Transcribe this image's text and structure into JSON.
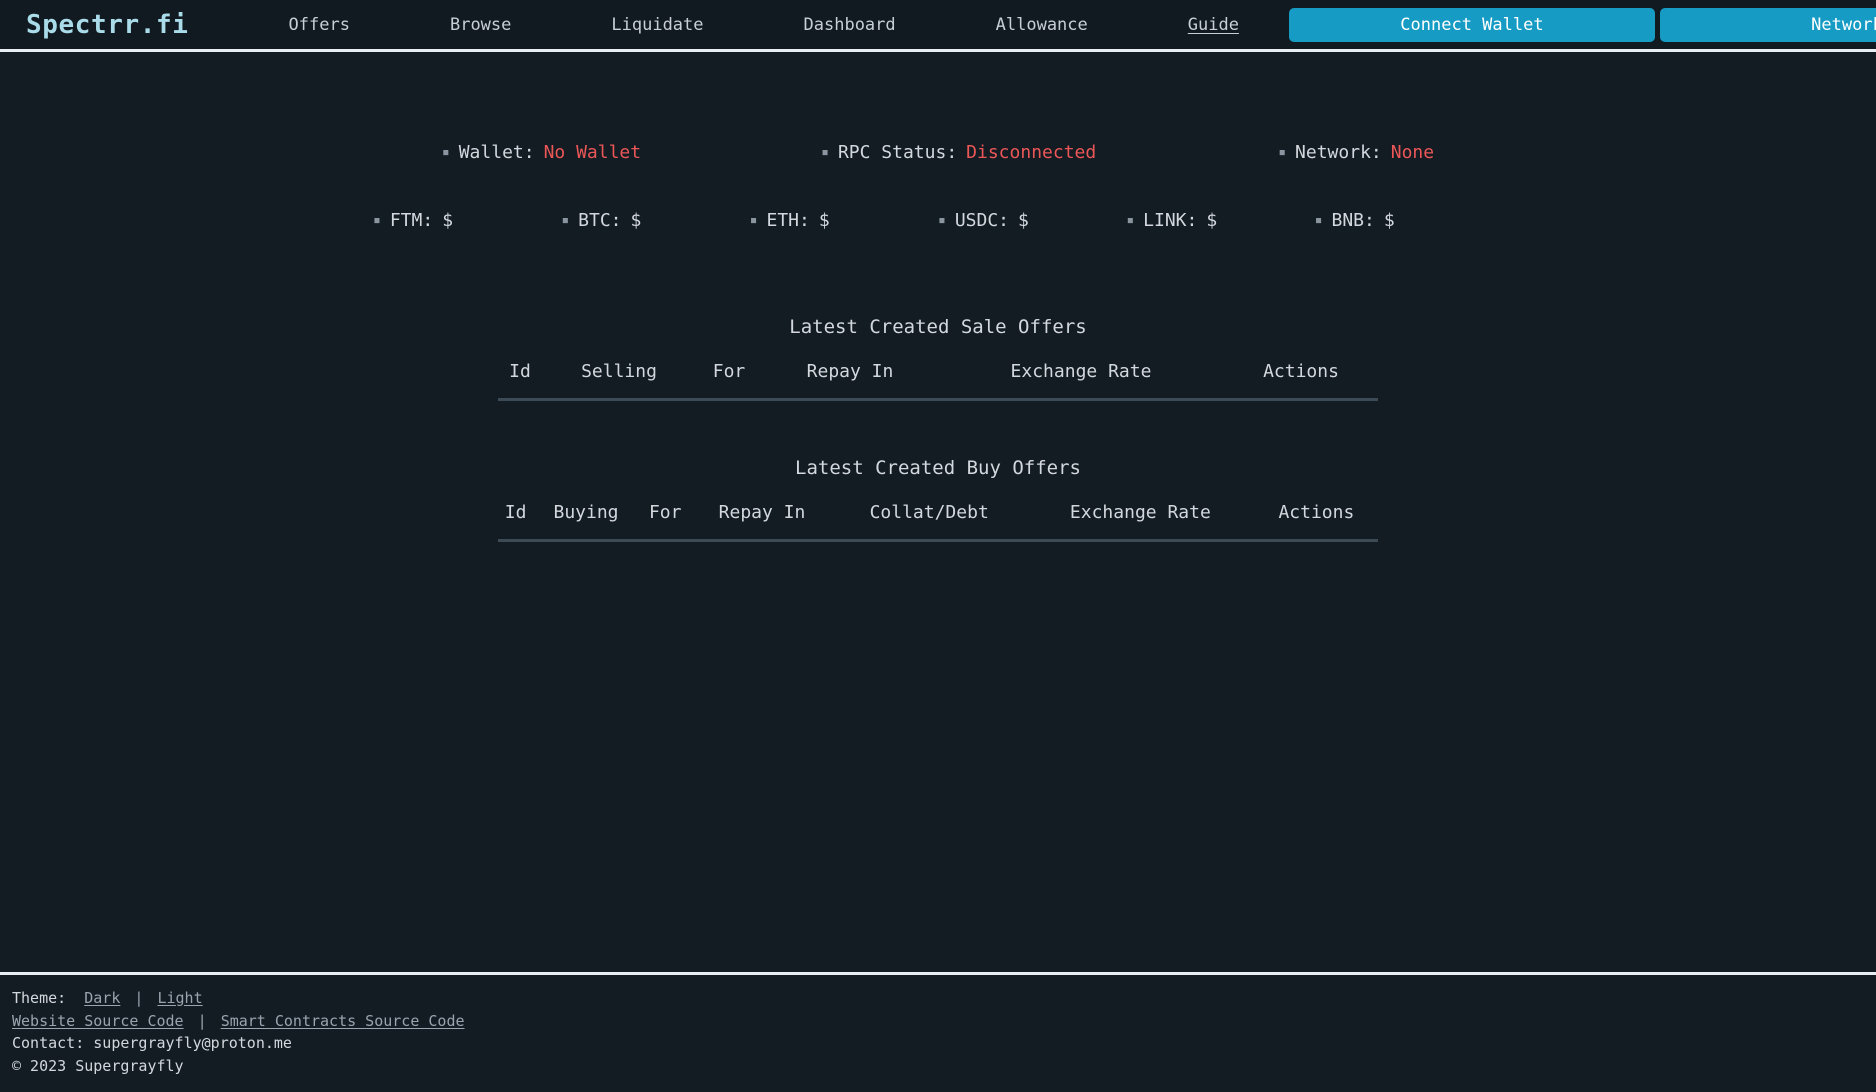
{
  "brand": "Spectrr.fi",
  "nav": {
    "links": [
      {
        "label": "Offers",
        "active": false
      },
      {
        "label": "Browse",
        "active": false
      },
      {
        "label": "Liquidate",
        "active": false
      },
      {
        "label": "Dashboard",
        "active": false
      },
      {
        "label": "Allowance",
        "active": false
      },
      {
        "label": "Guide",
        "active": true
      }
    ],
    "connect_wallet_label": "Connect Wallet",
    "network_label": "Network",
    "accent_color": "#169bc4",
    "brand_color": "#a9dbe8"
  },
  "status": {
    "bullet": "▪",
    "wallet_label": "Wallet:",
    "wallet_value": "No Wallet",
    "rpc_label": "RPC Status:",
    "rpc_value": "Disconnected",
    "network_label": "Network:",
    "network_value": "None",
    "error_color": "#eb5757"
  },
  "prices": [
    {
      "name": "FTM:",
      "value": "$"
    },
    {
      "name": "BTC:",
      "value": "$"
    },
    {
      "name": "ETH:",
      "value": "$"
    },
    {
      "name": "USDC:",
      "value": "$"
    },
    {
      "name": "LINK:",
      "value": "$"
    },
    {
      "name": "BNB:",
      "value": "$"
    }
  ],
  "sale_offers": {
    "title": "Latest Created Sale Offers",
    "columns": [
      "Id",
      "Selling",
      "For",
      "Repay In",
      "Exchange Rate",
      "Actions"
    ],
    "rows": []
  },
  "buy_offers": {
    "title": "Latest Created Buy Offers",
    "columns": [
      "Id",
      "Buying",
      "For",
      "Repay In",
      "Collat/Debt",
      "Exchange Rate",
      "Actions"
    ],
    "rows": []
  },
  "footer": {
    "theme_label": "Theme:",
    "theme_dark": "Dark",
    "theme_light": "Light",
    "separator": "|",
    "website_source": "Website Source Code",
    "contracts_source": "Smart Contracts Source Code",
    "contact": "Contact: supergrayfly@proton.me",
    "copyright": "© 2023 Supergrayfly"
  }
}
